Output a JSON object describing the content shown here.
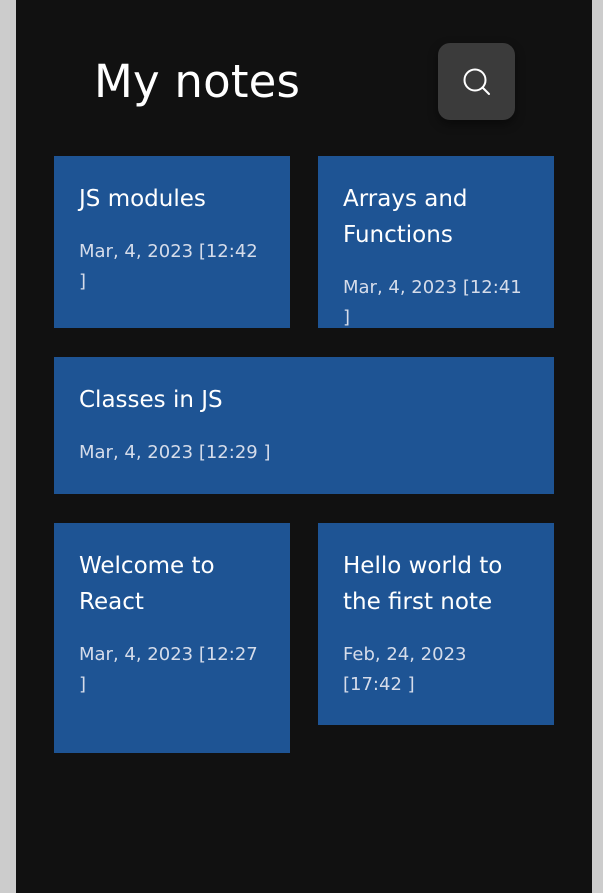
{
  "header": {
    "title": "My notes",
    "search_icon": "search-icon"
  },
  "colors": {
    "background": "#111111",
    "card": "#1e5494",
    "search_button": "#3b3b3b",
    "side_bars": "#cccccc"
  },
  "notes": [
    {
      "title": "JS modules",
      "date": "Mar, 4, 2023 [12:42 ]"
    },
    {
      "title": "Arrays and Functions",
      "date": "Mar, 4, 2023 [12:41 ]"
    },
    {
      "title": "Classes in JS",
      "date": "Mar, 4, 2023 [12:29 ]"
    },
    {
      "title": "Welcome to React",
      "date": "Mar, 4, 2023 [12:27 ]"
    },
    {
      "title": "Hello world to the first note",
      "date": "Feb, 24, 2023 [17:42 ]"
    }
  ]
}
